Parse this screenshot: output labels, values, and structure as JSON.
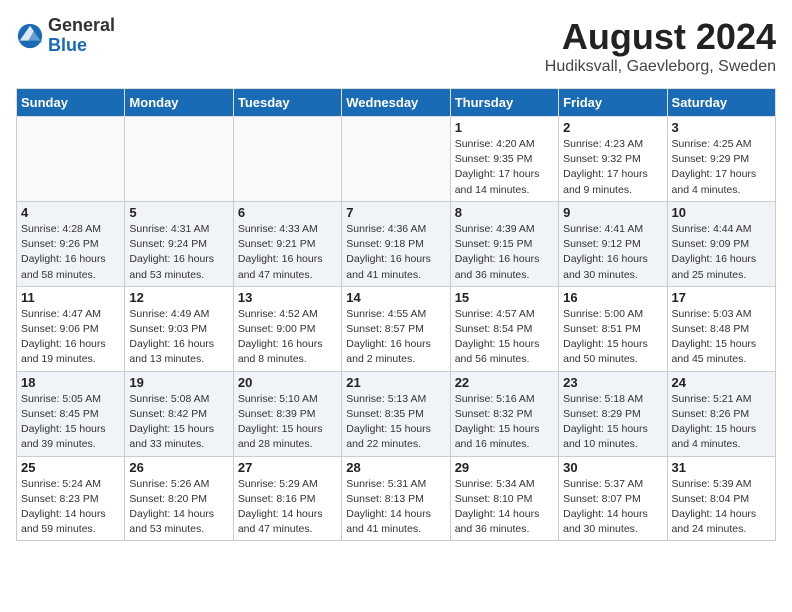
{
  "logo": {
    "general": "General",
    "blue": "Blue"
  },
  "title": {
    "month": "August 2024",
    "location": "Hudiksvall, Gaevleborg, Sweden"
  },
  "weekdays": [
    "Sunday",
    "Monday",
    "Tuesday",
    "Wednesday",
    "Thursday",
    "Friday",
    "Saturday"
  ],
  "weeks": [
    [
      {
        "day": "",
        "info": ""
      },
      {
        "day": "",
        "info": ""
      },
      {
        "day": "",
        "info": ""
      },
      {
        "day": "",
        "info": ""
      },
      {
        "day": "1",
        "info": "Sunrise: 4:20 AM\nSunset: 9:35 PM\nDaylight: 17 hours\nand 14 minutes."
      },
      {
        "day": "2",
        "info": "Sunrise: 4:23 AM\nSunset: 9:32 PM\nDaylight: 17 hours\nand 9 minutes."
      },
      {
        "day": "3",
        "info": "Sunrise: 4:25 AM\nSunset: 9:29 PM\nDaylight: 17 hours\nand 4 minutes."
      }
    ],
    [
      {
        "day": "4",
        "info": "Sunrise: 4:28 AM\nSunset: 9:26 PM\nDaylight: 16 hours\nand 58 minutes."
      },
      {
        "day": "5",
        "info": "Sunrise: 4:31 AM\nSunset: 9:24 PM\nDaylight: 16 hours\nand 53 minutes."
      },
      {
        "day": "6",
        "info": "Sunrise: 4:33 AM\nSunset: 9:21 PM\nDaylight: 16 hours\nand 47 minutes."
      },
      {
        "day": "7",
        "info": "Sunrise: 4:36 AM\nSunset: 9:18 PM\nDaylight: 16 hours\nand 41 minutes."
      },
      {
        "day": "8",
        "info": "Sunrise: 4:39 AM\nSunset: 9:15 PM\nDaylight: 16 hours\nand 36 minutes."
      },
      {
        "day": "9",
        "info": "Sunrise: 4:41 AM\nSunset: 9:12 PM\nDaylight: 16 hours\nand 30 minutes."
      },
      {
        "day": "10",
        "info": "Sunrise: 4:44 AM\nSunset: 9:09 PM\nDaylight: 16 hours\nand 25 minutes."
      }
    ],
    [
      {
        "day": "11",
        "info": "Sunrise: 4:47 AM\nSunset: 9:06 PM\nDaylight: 16 hours\nand 19 minutes."
      },
      {
        "day": "12",
        "info": "Sunrise: 4:49 AM\nSunset: 9:03 PM\nDaylight: 16 hours\nand 13 minutes."
      },
      {
        "day": "13",
        "info": "Sunrise: 4:52 AM\nSunset: 9:00 PM\nDaylight: 16 hours\nand 8 minutes."
      },
      {
        "day": "14",
        "info": "Sunrise: 4:55 AM\nSunset: 8:57 PM\nDaylight: 16 hours\nand 2 minutes."
      },
      {
        "day": "15",
        "info": "Sunrise: 4:57 AM\nSunset: 8:54 PM\nDaylight: 15 hours\nand 56 minutes."
      },
      {
        "day": "16",
        "info": "Sunrise: 5:00 AM\nSunset: 8:51 PM\nDaylight: 15 hours\nand 50 minutes."
      },
      {
        "day": "17",
        "info": "Sunrise: 5:03 AM\nSunset: 8:48 PM\nDaylight: 15 hours\nand 45 minutes."
      }
    ],
    [
      {
        "day": "18",
        "info": "Sunrise: 5:05 AM\nSunset: 8:45 PM\nDaylight: 15 hours\nand 39 minutes."
      },
      {
        "day": "19",
        "info": "Sunrise: 5:08 AM\nSunset: 8:42 PM\nDaylight: 15 hours\nand 33 minutes."
      },
      {
        "day": "20",
        "info": "Sunrise: 5:10 AM\nSunset: 8:39 PM\nDaylight: 15 hours\nand 28 minutes."
      },
      {
        "day": "21",
        "info": "Sunrise: 5:13 AM\nSunset: 8:35 PM\nDaylight: 15 hours\nand 22 minutes."
      },
      {
        "day": "22",
        "info": "Sunrise: 5:16 AM\nSunset: 8:32 PM\nDaylight: 15 hours\nand 16 minutes."
      },
      {
        "day": "23",
        "info": "Sunrise: 5:18 AM\nSunset: 8:29 PM\nDaylight: 15 hours\nand 10 minutes."
      },
      {
        "day": "24",
        "info": "Sunrise: 5:21 AM\nSunset: 8:26 PM\nDaylight: 15 hours\nand 4 minutes."
      }
    ],
    [
      {
        "day": "25",
        "info": "Sunrise: 5:24 AM\nSunset: 8:23 PM\nDaylight: 14 hours\nand 59 minutes."
      },
      {
        "day": "26",
        "info": "Sunrise: 5:26 AM\nSunset: 8:20 PM\nDaylight: 14 hours\nand 53 minutes."
      },
      {
        "day": "27",
        "info": "Sunrise: 5:29 AM\nSunset: 8:16 PM\nDaylight: 14 hours\nand 47 minutes."
      },
      {
        "day": "28",
        "info": "Sunrise: 5:31 AM\nSunset: 8:13 PM\nDaylight: 14 hours\nand 41 minutes."
      },
      {
        "day": "29",
        "info": "Sunrise: 5:34 AM\nSunset: 8:10 PM\nDaylight: 14 hours\nand 36 minutes."
      },
      {
        "day": "30",
        "info": "Sunrise: 5:37 AM\nSunset: 8:07 PM\nDaylight: 14 hours\nand 30 minutes."
      },
      {
        "day": "31",
        "info": "Sunrise: 5:39 AM\nSunset: 8:04 PM\nDaylight: 14 hours\nand 24 minutes."
      }
    ]
  ]
}
